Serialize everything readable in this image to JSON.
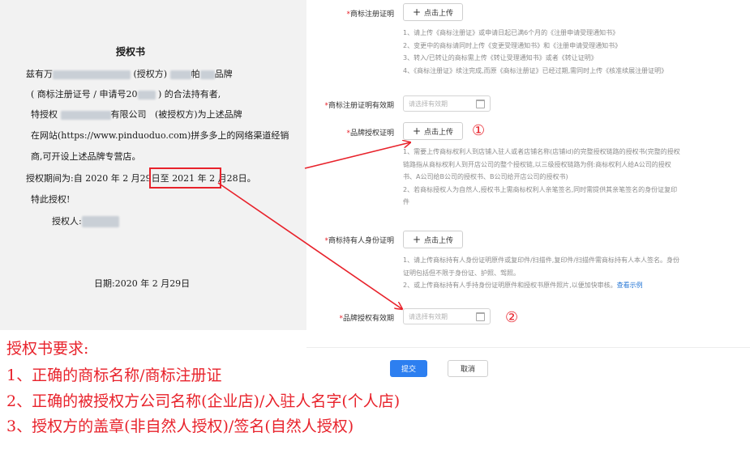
{
  "document": {
    "title": "授权书",
    "line1_prefix": "兹有万",
    "line1_mid": "(授权方)",
    "line1_mid2": "帕",
    "line1_suffix": "品牌",
    "line2_prefix": "( 商标注册证号 / 申请号",
    "line2_num": "20",
    "line2_suffix": ") 的合法持有者,",
    "line3_prefix": "特授权",
    "line3_mid": "有限公司",
    "line3_suffix": "(被授权方)为上述品牌",
    "line4": "在网站(https://www.pinduoduo.com)拼多多上的网络渠道经销",
    "line5": "商,可开设上述品牌专营店。",
    "period_prefix": "授权期间为:自 2020 年 2 月29日至",
    "period_end": "2021 年 2 月28日。",
    "special": "特此授权!",
    "grantor": "授权人:",
    "date": "日期:2020 年 2 月29日"
  },
  "form": {
    "fields": [
      {
        "label": "商标注册证明",
        "required": true,
        "button": "点击上传"
      },
      {
        "label": "商标注册证明有效期",
        "required": true,
        "placeholder": "请选择有效期"
      },
      {
        "label": "品牌授权证明",
        "required": true,
        "button": "点击上传"
      },
      {
        "label": "商标持有人身份证明",
        "required": true,
        "button": "点击上传"
      },
      {
        "label": "品牌授权有效期",
        "required": true,
        "placeholder": "请选择有效期"
      }
    ],
    "trademark_notes": [
      "1、请上传《商标注册证》或申请日起已满6个月的《注册申请受理通知书》",
      "2、变更中的商标请同时上传《变更受理通知书》和《注册申请受理通知书》",
      "3、转入/已转让的商标需上传《转让受理通知书》或者《转让证明》",
      "4、《商标注册证》续注完成,而原《商标注册证》已经过期,需同时上传《核准续展注册证明》"
    ],
    "brand_auth_notes": [
      "1、需要上传商标权利人到店铺入驻人或者店铺名称(店铺id)的完整授权链路的授权书(完整的授权",
      "链路指从商标权利人到开店公司的整个授权链,以三级授权链路为例:商标权利人给A公司的授权",
      "书、A公司给B公司的授权书、B公司给开店公司的授权书)",
      "2、若商标授权人为自然人,授权书上需商标权利人亲笔签名,同时需提供其亲笔签名的身份证复印",
      "件"
    ],
    "holder_notes": [
      "1、请上传商标持有人身份证明原件或复印件/扫描件,复印件/扫描件需商标持有人本人签名。身份",
      "证明包括但不限于身份证、护照、驾照。",
      "2、或上传商标持有人手持身份证明原件和授权书原件照片,以便加快审核。"
    ],
    "holder_link": "查看示例",
    "submit": "提交",
    "cancel": "取消"
  },
  "markers": {
    "one": "①",
    "two": "②"
  },
  "requirements": {
    "title": "授权书要求:",
    "items": [
      "1、正确的商标名称/商标注册证",
      "2、正确的被授权方公司名称(企业店)/入驻人名字(个人店)",
      "3、授权方的盖章(非自然人授权)/签名(自然人授权)"
    ]
  },
  "colors": {
    "accent_red": "#e8222b",
    "primary_blue": "#2d7ff0",
    "link_blue": "#2878d6"
  }
}
